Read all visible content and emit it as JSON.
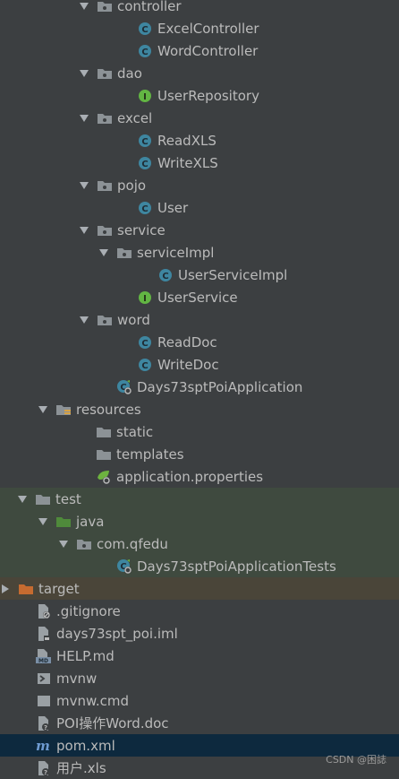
{
  "tree": {
    "items": [
      {
        "label": "controller",
        "icon": "package-folder-icon"
      },
      {
        "label": "ExcelController",
        "icon": "class-icon"
      },
      {
        "label": "WordController",
        "icon": "class-icon"
      },
      {
        "label": "dao",
        "icon": "package-folder-icon"
      },
      {
        "label": "UserRepository",
        "icon": "interface-icon"
      },
      {
        "label": "excel",
        "icon": "package-folder-icon"
      },
      {
        "label": "ReadXLS",
        "icon": "class-icon"
      },
      {
        "label": "WriteXLS",
        "icon": "class-icon"
      },
      {
        "label": "pojo",
        "icon": "package-folder-icon"
      },
      {
        "label": "User",
        "icon": "class-icon"
      },
      {
        "label": "service",
        "icon": "package-folder-icon"
      },
      {
        "label": "serviceImpl",
        "icon": "package-folder-icon"
      },
      {
        "label": "UserServiceImpl",
        "icon": "class-icon"
      },
      {
        "label": "UserService",
        "icon": "interface-icon"
      },
      {
        "label": "word",
        "icon": "package-folder-icon"
      },
      {
        "label": "ReadDoc",
        "icon": "class-icon"
      },
      {
        "label": "WriteDoc",
        "icon": "class-icon"
      },
      {
        "label": "Days73sptPoiApplication",
        "icon": "spring-boot-class-icon"
      },
      {
        "label": "resources",
        "icon": "resources-folder-icon"
      },
      {
        "label": "static",
        "icon": "folder-icon"
      },
      {
        "label": "templates",
        "icon": "folder-icon"
      },
      {
        "label": "application.properties",
        "icon": "spring-properties-icon"
      },
      {
        "label": "test",
        "icon": "folder-icon"
      },
      {
        "label": "java",
        "icon": "test-source-folder-icon"
      },
      {
        "label": "com.qfedu",
        "icon": "package-folder-icon"
      },
      {
        "label": "Days73sptPoiApplicationTests",
        "icon": "spring-boot-test-class-icon"
      },
      {
        "label": "target",
        "icon": "excluded-folder-icon"
      },
      {
        "label": ".gitignore",
        "icon": "ignored-file-icon"
      },
      {
        "label": "days73spt_poi.iml",
        "icon": "iml-file-icon"
      },
      {
        "label": "HELP.md",
        "icon": "markdown-file-icon"
      },
      {
        "label": "mvnw",
        "icon": "shell-script-icon"
      },
      {
        "label": "mvnw.cmd",
        "icon": "text-file-icon"
      },
      {
        "label": "POI操作Word.doc",
        "icon": "unknown-file-icon"
      },
      {
        "label": "pom.xml",
        "icon": "maven-icon"
      },
      {
        "label": "用户.xls",
        "icon": "unknown-file-icon"
      }
    ]
  },
  "watermark": "CSDN @困誌",
  "colors": {
    "background": "#3c3f41",
    "text": "#bbbbbb",
    "test_highlight": "#3f4a3f",
    "excluded_highlight": "#4a4539",
    "selection": "#0d293e",
    "class_icon": "#3e86a0",
    "interface_icon": "#62b543",
    "folder_icon": "#8c9296",
    "excluded_folder": "#c66b30",
    "test_folder": "#4f8a3b"
  }
}
